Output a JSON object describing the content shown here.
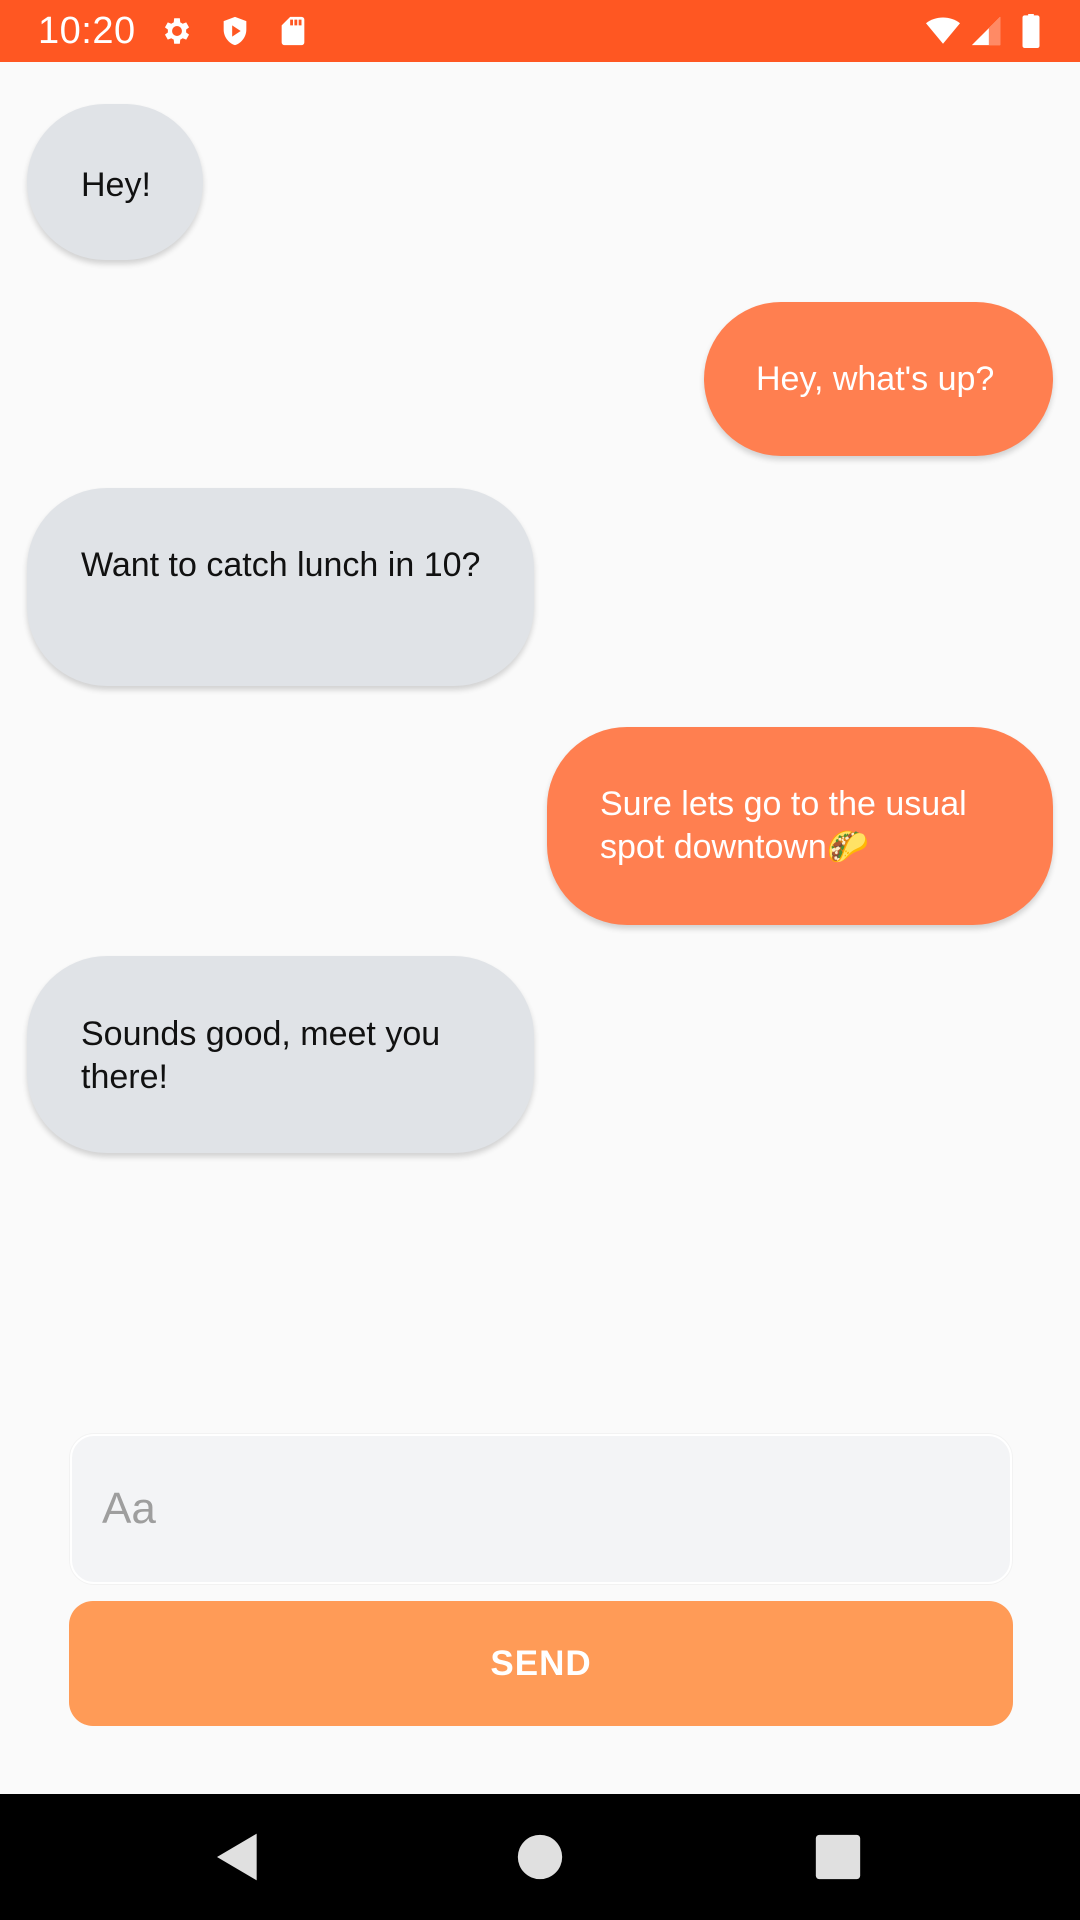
{
  "status_bar": {
    "time": "10:20",
    "background": "#ff5722",
    "left_icons": [
      "settings-icon",
      "shield-icon",
      "sd-card-icon"
    ],
    "right_icons": [
      "wifi-icon",
      "cell-signal-icon",
      "battery-icon"
    ]
  },
  "messages": [
    {
      "direction": "incoming",
      "text": "Hey!"
    },
    {
      "direction": "outgoing",
      "text": "Hey, what's up?"
    },
    {
      "direction": "incoming",
      "text": "Want to catch lunch in 10?"
    },
    {
      "direction": "outgoing",
      "text": "Sure lets go to the usual spot downtown🌮"
    },
    {
      "direction": "incoming",
      "text": "Sounds good, meet you there!"
    }
  ],
  "compose": {
    "placeholder": "Aa",
    "value": "",
    "send_label": "SEND"
  },
  "colors": {
    "incoming_bubble": "#e0e3e7",
    "outgoing_bubble": "#ff7f50",
    "send_button": "#ff9b57",
    "status_bar": "#ff5722"
  },
  "nav_bar": {
    "buttons": [
      "back-icon",
      "home-icon",
      "recents-icon"
    ]
  }
}
